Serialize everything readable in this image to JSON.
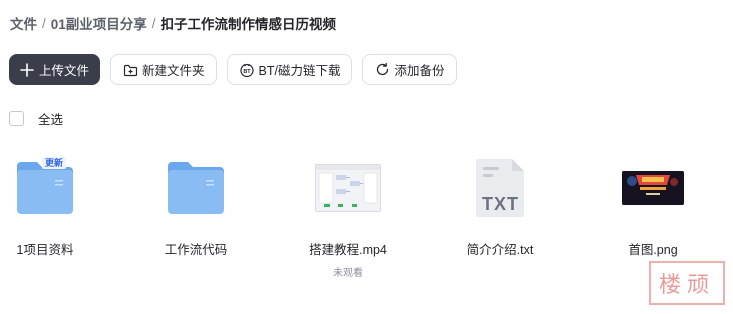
{
  "breadcrumb": [
    "文件",
    "01副业项目分享",
    "扣子工作流制作情感日历视频"
  ],
  "breadcrumb_separator": "/",
  "toolbar": {
    "upload": "上传文件",
    "new_folder": "新建文件夹",
    "magnet": "BT/磁力链下载",
    "backup": "添加备份"
  },
  "select_all": "全选",
  "files": [
    {
      "name": "1项目资料",
      "type": "folder",
      "badge": "更新",
      "icon": "folder-icon"
    },
    {
      "name": "工作流代码",
      "type": "folder",
      "icon": "folder-icon"
    },
    {
      "name": "搭建教程.mp4",
      "type": "video",
      "status": "未观看",
      "icon": "video-thumbnail"
    },
    {
      "name": "简介介绍.txt",
      "type": "text",
      "ext_label": "TXT",
      "icon": "txt-file-icon"
    },
    {
      "name": "首图.png",
      "type": "image",
      "icon": "image-thumbnail"
    }
  ],
  "watermark": "楼顽",
  "colors": {
    "primary_button": "#3a3d4a",
    "folder": "#7fb6f1",
    "badge": "#2c64e8",
    "text": "#25262b"
  }
}
